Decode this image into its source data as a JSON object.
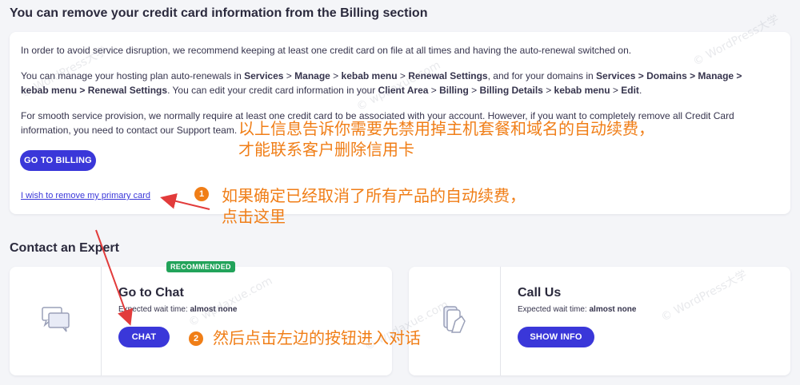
{
  "billing_section": {
    "title": "You can remove your credit card information from the Billing section",
    "p1": "In order to avoid service disruption, we recommend keeping at least one credit card on file at all times and having the auto-renewal switched on.",
    "p2": {
      "t1": "You can manage your hosting plan auto-renewals in ",
      "b1": "Services",
      "t2": " > ",
      "b2": "Manage",
      "t3": " > ",
      "b3": "kebab menu",
      "t4": " > ",
      "b4": "Renewal Settings",
      "t5": ", and for your domains in ",
      "b5": "Services > Domains > Manage >",
      "b6": "kebab menu > Renewal Settings",
      "t6": ". You can edit your credit card information in your ",
      "b7": "Client Area",
      "t7": " > ",
      "b8": "Billing",
      "t8": " > ",
      "b9": "Billing Details",
      "t9": " > ",
      "b10": "kebab menu",
      "t10": " > ",
      "b11": "Edit",
      "t11": "."
    },
    "p3": {
      "line1_left": "For smooth service provision, we normally require at least one credit card to be associated with your account. However, if you want to completely remove all Credit Card",
      "line2": "information, you need to contact our Support team."
    },
    "go_to_billing_label": "GO TO BILLING",
    "remove_primary_link": "I wish to remove my primary card"
  },
  "contact_section": {
    "title": "Contact an Expert",
    "chat": {
      "badge": "RECOMMENDED",
      "title": "Go to Chat",
      "wait_label": "Expected wait time: ",
      "wait_value": "almost none",
      "button": "CHAT"
    },
    "call": {
      "title": "Call Us",
      "wait_label": "Expected wait time: ",
      "wait_value": "almost none",
      "button": "SHOW INFO"
    }
  },
  "annotations": {
    "note_line1": "以上信息告诉你需要先禁用掉主机套餐和域名的自动续费，",
    "note_line2": "才能联系客户删除信用卡",
    "step1_num": "1",
    "step1_line1": "如果确定已经取消了所有产品的自动续费，",
    "step1_line2": "点击这里",
    "step2_num": "2",
    "step2_text": "然后点击左边的按钮进入对话"
  },
  "watermarks": [
    "© WordPress大学",
    "© wpdaxue.com",
    "© WordPress大学",
    "© wpdaxue.com",
    "© WordPress大学",
    "© wpdaxue.com"
  ],
  "colors": {
    "accent": "#3a37d9",
    "annotation": "#f07e17",
    "badge": "#22a35a",
    "arrow": "#e23b3b"
  },
  "icons": {
    "chat": "chat-bubbles-icon",
    "call": "phone-hand-icon"
  }
}
